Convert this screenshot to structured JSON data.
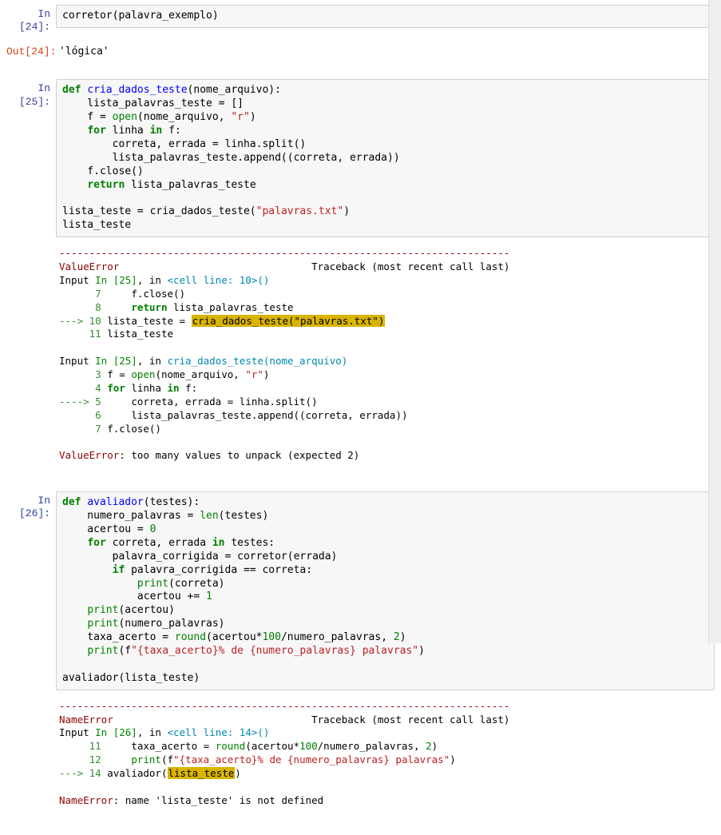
{
  "cell24": {
    "in_prompt": "In [24]:",
    "out_prompt": "Out[24]:",
    "code": "corretor(palavra_exemplo)",
    "output": "'lógica'"
  },
  "cell25": {
    "in_prompt": "In [25]:",
    "code_lines": {
      "l1a": "def ",
      "l1b": "cria_dados_teste",
      "l1c": "(nome_arquivo):",
      "l2": "    lista_palavras_teste = []",
      "l3a": "    f = ",
      "l3b": "open",
      "l3c": "(nome_arquivo, ",
      "l3d": "\"r\"",
      "l3e": ")",
      "l4a": "    ",
      "l4b": "for",
      "l4c": " linha ",
      "l4d": "in",
      "l4e": " f:",
      "l5": "        correta, errada = linha.split()",
      "l6": "        lista_palavras_teste.append((correta, errada))",
      "l7": "    f.close()",
      "l8a": "    ",
      "l8b": "return",
      "l8c": " lista_palavras_teste",
      "l10a": "lista_teste = cria_dados_teste(",
      "l10b": "\"palavras.txt\"",
      "l10c": ")",
      "l11": "lista_teste"
    },
    "tb": {
      "dash": "---------------------------------------------------------------------------",
      "hdr1": "ValueError",
      "hdr2": "                                Traceback (most recent call last)",
      "r1a": "Input ",
      "r1b": "In [25]",
      "r1c": ", in ",
      "r1d": "<cell line: 10>",
      "r1e": "()",
      "r2a": "      7",
      "r2b": "     f.close()",
      "r3a": "      8",
      "r3b": "     ",
      "r3c": "return",
      "r3d": " lista_palavras_teste",
      "r4a": "---> ",
      "r4b": "10",
      "r4c": " lista_teste = ",
      "r4d": "cria_dados_teste(\"palavras.txt\")",
      "r5a": "     11",
      "r5b": " lista_teste",
      "r6a": "Input ",
      "r6b": "In [25]",
      "r6c": ", in ",
      "r6d": "cria_dados_teste",
      "r6e": "(nome_arquivo)",
      "r7a": "      3",
      "r7b": " f = ",
      "r7c": "open",
      "r7d": "(nome_arquivo, ",
      "r7e": "\"r\"",
      "r7f": ")",
      "r8a": "      4",
      "r8b": " ",
      "r8c": "for",
      "r8d": " linha ",
      "r8e": "in",
      "r8f": " f:",
      "r9a": "----> ",
      "r9b": "5",
      "r9c": "     correta, errada = linha.split()",
      "r10a": "      6",
      "r10b": "     lista_palavras_teste.append((correta, errada))",
      "r11a": "      7",
      "r11b": " f.close()",
      "msg1": "ValueError",
      "msg2": ": too many values to unpack (expected 2)"
    }
  },
  "cell26": {
    "in_prompt": "In [26]:",
    "code_lines": {
      "l1a": "def ",
      "l1b": "avaliador",
      "l1c": "(testes):",
      "l2a": "    numero_palavras = ",
      "l2b": "len",
      "l2c": "(testes)",
      "l3a": "    acertou = ",
      "l3b": "0",
      "l4a": "    ",
      "l4b": "for",
      "l4c": " correta, errada ",
      "l4d": "in",
      "l4e": " testes:",
      "l5": "        palavra_corrigida = corretor(errada)",
      "l6a": "        ",
      "l6b": "if",
      "l6c": " palavra_corrigida == correta:",
      "l7a": "            ",
      "l7b": "print",
      "l7c": "(correta)",
      "l8a": "            acertou += ",
      "l8b": "1",
      "l9a": "    ",
      "l9b": "print",
      "l9c": "(acertou)",
      "l10a": "    ",
      "l10b": "print",
      "l10c": "(numero_palavras)",
      "l11a": "    taxa_acerto = ",
      "l11b": "round",
      "l11c": "(acertou*",
      "l11d": "100",
      "l11e": "/numero_palavras, ",
      "l11f": "2",
      "l11g": ")",
      "l12a": "    ",
      "l12b": "print",
      "l12c": "(f",
      "l12d": "\"{taxa_acerto}% de {numero_palavras} palavras\"",
      "l12e": ")",
      "l14": "avaliador(lista_teste)"
    },
    "tb": {
      "dash": "---------------------------------------------------------------------------",
      "hdr1": "NameError",
      "hdr2": "                                 Traceback (most recent call last)",
      "r1a": "Input ",
      "r1b": "In [26]",
      "r1c": ", in ",
      "r1d": "<cell line: 14>",
      "r1e": "()",
      "r2a": "     11",
      "r2b": "     taxa_acerto = ",
      "r2c": "round",
      "r2d": "(acertou*",
      "r2e": "100",
      "r2f": "/numero_palavras, ",
      "r2g": "2",
      "r2h": ")",
      "r3a": "     12",
      "r3b": "     ",
      "r3c": "print",
      "r3d": "(f",
      "r3e": "\"{taxa_acerto}% de {numero_palavras} palavras\"",
      "r3f": ")",
      "r4a": "---> ",
      "r4b": "14",
      "r4c": " avaliador(",
      "r4d": "lista_teste",
      "r4e": ")",
      "msg1": "NameError",
      "msg2": ": name 'lista_teste' is not defined"
    }
  }
}
